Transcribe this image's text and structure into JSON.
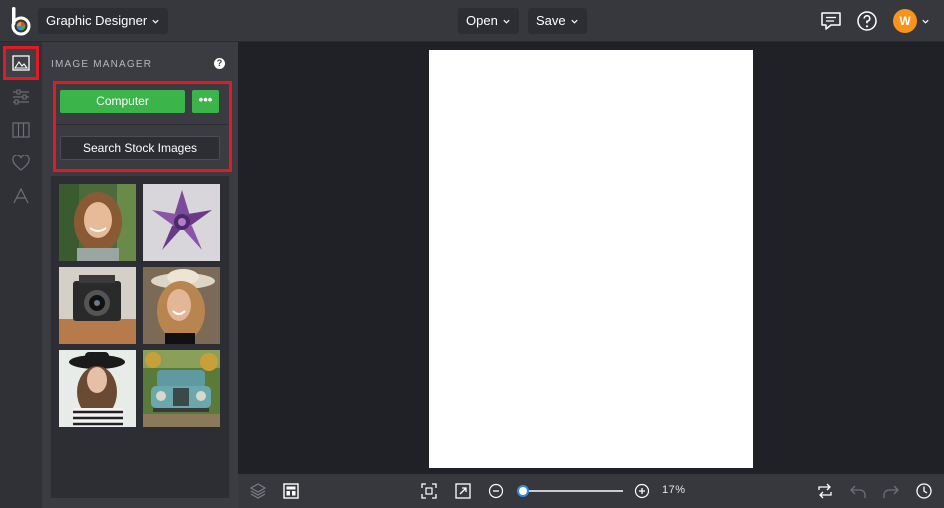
{
  "app": {
    "name": "Graphic Designer"
  },
  "menu": {
    "open": "Open",
    "save": "Save"
  },
  "user": {
    "initial": "W"
  },
  "panel": {
    "title": "IMAGE MANAGER",
    "help": "?",
    "computer_button": "Computer",
    "more_button": "•••",
    "stock_button": "Search Stock Images"
  },
  "gallery": {
    "images": [
      {
        "name": "woman-smiling"
      },
      {
        "name": "purple-succulent"
      },
      {
        "name": "vintage-camera"
      },
      {
        "name": "woman-hat-laughing"
      },
      {
        "name": "woman-black-hat"
      },
      {
        "name": "vintage-blue-truck"
      }
    ]
  },
  "zoom": {
    "value": "17%",
    "fraction": 0.17
  },
  "colors": {
    "accent_green": "#3bb54a",
    "highlight_red": "#e01b24",
    "avatar_orange": "#f7941d"
  }
}
